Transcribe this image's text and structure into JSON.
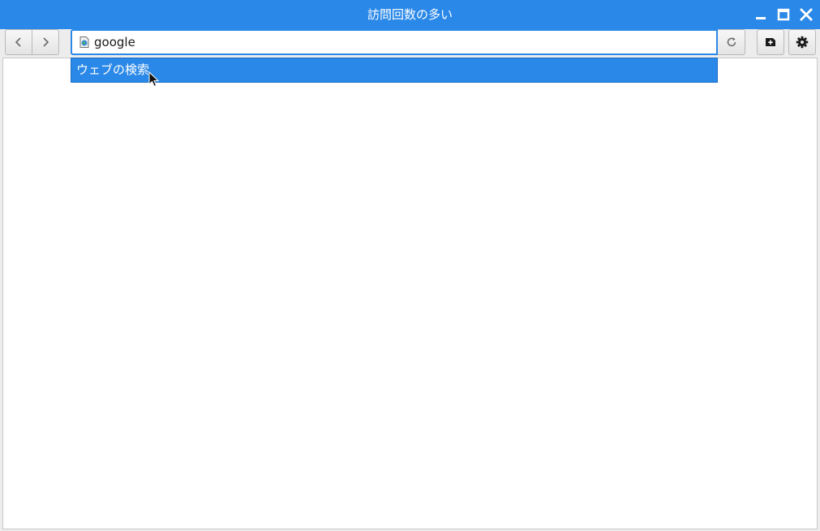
{
  "window": {
    "title": "訪問回数の多い"
  },
  "toolbar": {
    "url_value": "google",
    "url_placeholder": ""
  },
  "suggestions": [
    {
      "label": "ウェブの検索"
    }
  ],
  "icons": {
    "back": "chevron-left-icon",
    "forward": "chevron-right-icon",
    "reload": "reload-icon",
    "new_tab": "new-tab-icon",
    "settings": "gear-icon",
    "minimize": "minimize-icon",
    "maximize": "maximize-icon",
    "close": "close-icon",
    "site": "page-globe-icon"
  },
  "colors": {
    "accent": "#2a88e8",
    "titlebar_text": "#ffffff",
    "toolbar_bg": "#ededed",
    "content_bg": "#ffffff"
  }
}
